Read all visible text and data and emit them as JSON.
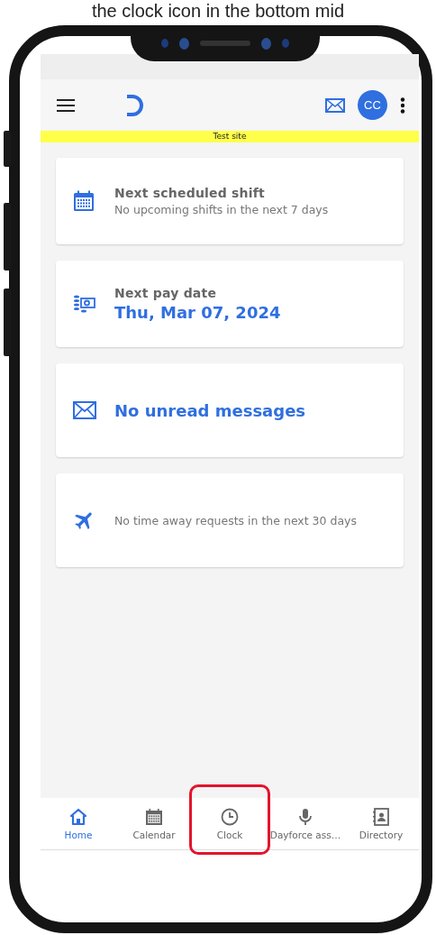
{
  "caption": "the clock icon in the bottom mid",
  "app_bar": {
    "avatar": "CC"
  },
  "banner": "Test site",
  "cards": [
    {
      "kind": "shift",
      "title": "Next scheduled shift",
      "text": "No upcoming shifts in the next 7 days"
    },
    {
      "kind": "pay",
      "title": "Next pay date",
      "text": "Thu, Mar 07, 2024"
    },
    {
      "kind": "messages",
      "text": "No unread messages"
    },
    {
      "kind": "time_away",
      "text": "No time away requests in the next 30 days"
    }
  ],
  "bottom_nav": [
    {
      "label": "Home",
      "selected": true,
      "highlighted": false
    },
    {
      "label": "Calendar",
      "selected": false,
      "highlighted": false
    },
    {
      "label": "Clock",
      "selected": false,
      "highlighted": true
    },
    {
      "label": "Dayforce ass…",
      "selected": false,
      "highlighted": false
    },
    {
      "label": "Directory",
      "selected": false,
      "highlighted": false
    }
  ]
}
